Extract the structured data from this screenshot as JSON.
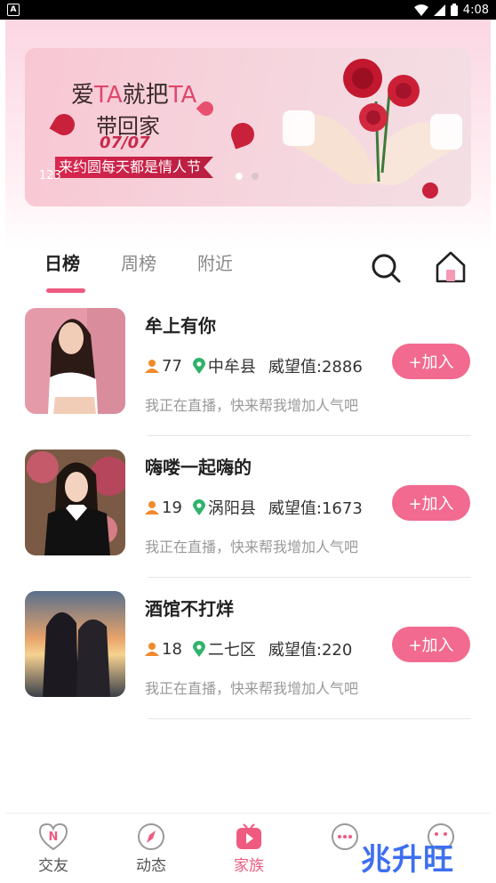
{
  "status_bar": {
    "app_badge": "A",
    "time": "4:08"
  },
  "banner": {
    "title_line1_a": "爱",
    "title_line1_ta1": "TA",
    "title_line1_b": "就把",
    "title_line1_ta2": "TA",
    "title_line2": "带回家",
    "date": "07/07",
    "ribbon": "来约圆每天都是情人节",
    "label": "123",
    "dots": [
      "active",
      "inactive"
    ]
  },
  "tabs": [
    {
      "label": "日榜",
      "active": true
    },
    {
      "label": "周榜",
      "active": false
    },
    {
      "label": "附近",
      "active": false
    }
  ],
  "list": [
    {
      "name": "牟上有你",
      "members": "77",
      "location": "中牟县",
      "prestige": "威望值:2886",
      "desc": "我正在直播，快来帮我增加人气吧",
      "join": "+加入"
    },
    {
      "name": "嗨喽一起嗨的",
      "members": "19",
      "location": "涡阳县",
      "prestige": "威望值:1673",
      "desc": "我正在直播，快来帮我增加人气吧",
      "join": "+加入"
    },
    {
      "name": "酒馆不打烊",
      "members": "18",
      "location": "二七区",
      "prestige": "威望值:220",
      "desc": "我正在直播，快来帮我增加人气吧",
      "join": "+加入"
    }
  ],
  "bottom_nav": [
    {
      "label": "交友",
      "icon": "heart-n-icon",
      "active": false
    },
    {
      "label": "动态",
      "icon": "compass-icon",
      "active": false
    },
    {
      "label": "家族",
      "icon": "tv-play-icon",
      "active": true
    }
  ],
  "watermark": "兆升旺",
  "colors": {
    "accent": "#ef5a80",
    "join_button": "#f26a8f",
    "icon_orange": "#f08a2c",
    "icon_green": "#2fb36b"
  }
}
